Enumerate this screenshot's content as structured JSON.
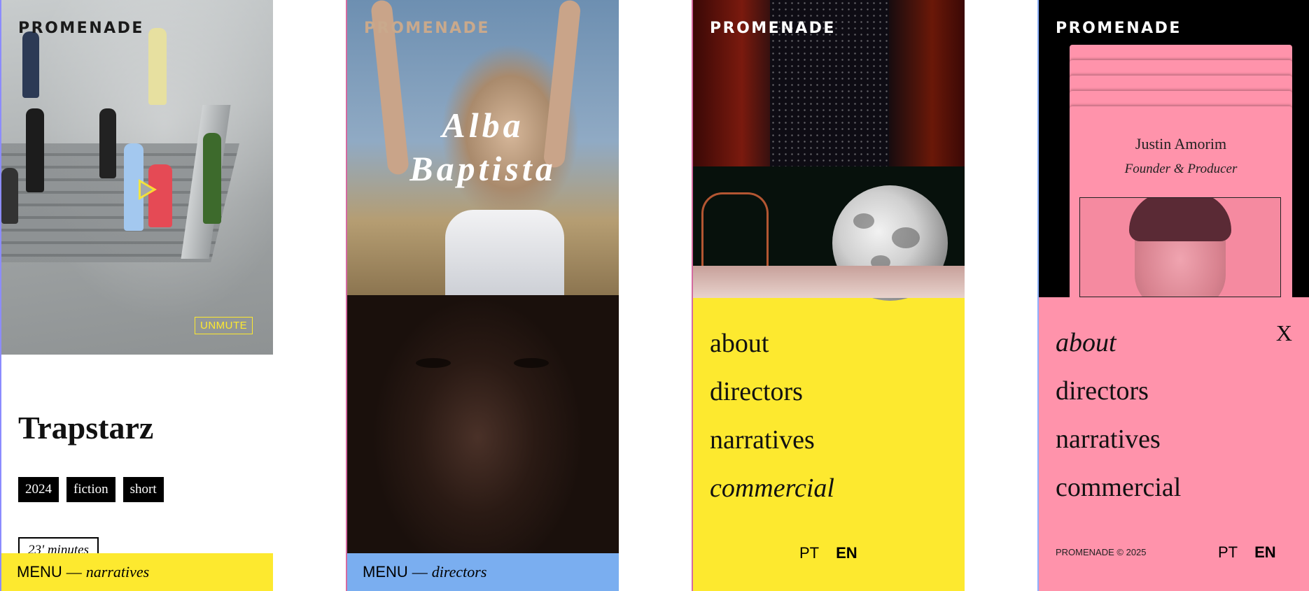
{
  "brand": "PROMENADE",
  "colors": {
    "yellow": "#fde92f",
    "blue": "#7aaef0",
    "pink": "#ff93ab",
    "black": "#000000"
  },
  "screen1": {
    "unmute_label": "UNMUTE",
    "play_icon": "play-icon",
    "title": "Trapstarz",
    "tags": [
      "2024",
      "fiction",
      "short"
    ],
    "duration": "23' minutes",
    "menu": {
      "label": "MENU",
      "separator": "—",
      "section": "narratives"
    }
  },
  "screen2": {
    "name_line1": "Alba",
    "name_line2": "Baptista",
    "menu": {
      "label": "MENU",
      "separator": "—",
      "section": "directors"
    }
  },
  "screen3": {
    "nav": [
      "about",
      "directors",
      "narratives",
      "commercial"
    ],
    "active": "commercial",
    "lang_pt": "PT",
    "lang_en": "EN"
  },
  "screen4": {
    "profile_name": "Justin Amorim",
    "profile_role": "Founder & Producer",
    "nav": [
      "about",
      "directors",
      "narratives",
      "commercial"
    ],
    "active": "about",
    "close_label": "X",
    "copyright": "PROMENADE © 2025",
    "lang_pt": "PT",
    "lang_en": "EN"
  }
}
